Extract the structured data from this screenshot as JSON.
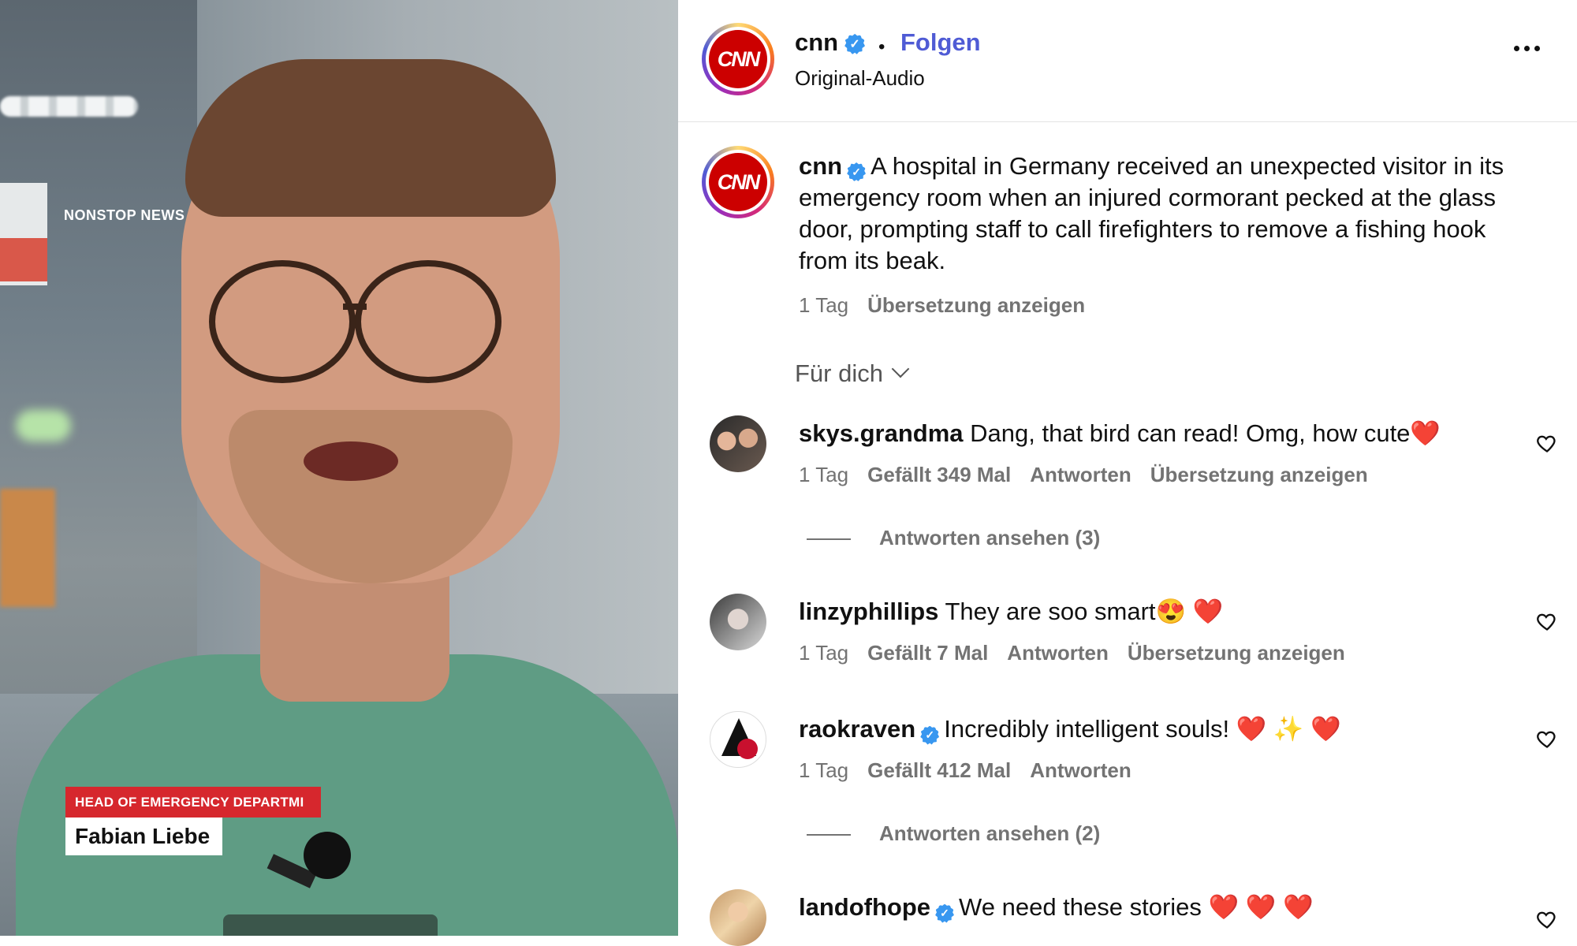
{
  "video": {
    "channel_tag": "NONSTOP NEWS",
    "lower_third_title": "HEAD OF EMERGENCY DEPARTMI",
    "lower_third_name": "Fabian Liebe"
  },
  "header": {
    "username": "cnn",
    "verified_icon": "verified-badge-icon",
    "separator": "•",
    "follow_label": "Folgen",
    "audio_label": "Original-Audio",
    "avatar_text": "CNN"
  },
  "post": {
    "username": "cnn",
    "caption": "A hospital in Germany received an unexpected visitor in its emergency room when an injured cormorant pecked at the glass door, prompting staff to call firefighters to remove a fishing hook from its beak.",
    "time": "1 Tag",
    "translate": "Übersetzung anzeigen"
  },
  "filter": {
    "label": "Für dich"
  },
  "comments": [
    {
      "username": "skys.grandma",
      "verified": false,
      "text": "Dang, that bird can read! Omg, how cute❤️",
      "time": "1 Tag",
      "likes": "Gefällt 349 Mal",
      "reply": "Antworten",
      "translate": "Übersetzung anzeigen",
      "view_replies": "Antworten ansehen (3)"
    },
    {
      "username": "linzyphillips",
      "verified": false,
      "text": "They are soo smart😍 ❤️",
      "time": "1 Tag",
      "likes": "Gefällt 7 Mal",
      "reply": "Antworten",
      "translate": "Übersetzung anzeigen"
    },
    {
      "username": "raokraven",
      "verified": true,
      "text": "Incredibly intelligent souls! ❤️ ✨ ❤️",
      "time": "1 Tag",
      "likes": "Gefällt 412 Mal",
      "reply": "Antworten",
      "view_replies": "Antworten ansehen (2)"
    },
    {
      "username": "landofhope",
      "verified": true,
      "text": "We need these stories ❤️ ❤️ ❤️"
    }
  ],
  "colors": {
    "follow": "#4f5bd5",
    "verified": "#3897f0",
    "cnn_red": "#cc0000",
    "muted": "#737373"
  }
}
